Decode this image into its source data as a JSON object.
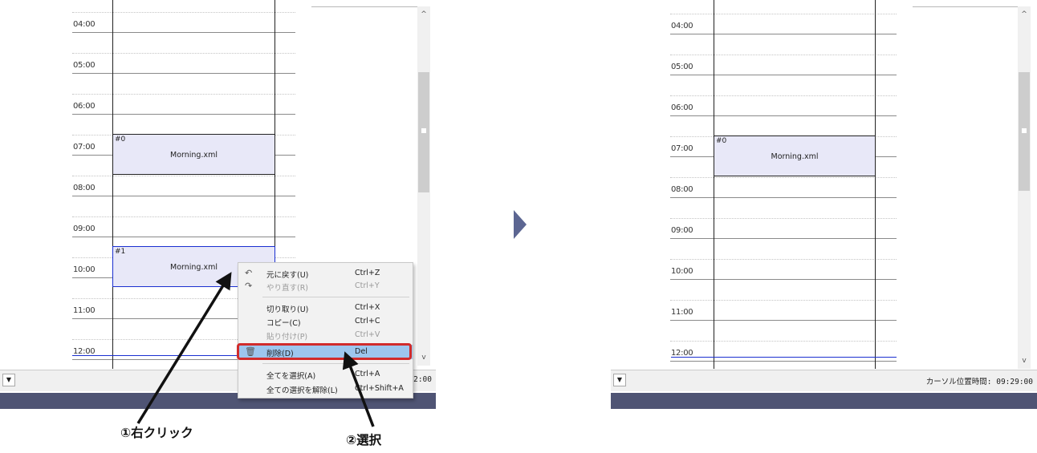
{
  "left": {
    "time_labels": [
      "04:00",
      "05:00",
      "06:00",
      "07:00",
      "08:00",
      "09:00",
      "10:00",
      "11:00",
      "12:00"
    ],
    "blocks": [
      {
        "id": "#0",
        "name": "Morning.xml",
        "selected": false
      },
      {
        "id": "#1",
        "name": "Morning.xml",
        "selected": true
      }
    ],
    "scroll_up": "^",
    "scroll_down": "v",
    "dropdown": "▼",
    "status_text": "2:00"
  },
  "right": {
    "time_labels": [
      "04:00",
      "05:00",
      "06:00",
      "07:00",
      "08:00",
      "09:00",
      "10:00",
      "11:00",
      "12:00"
    ],
    "blocks": [
      {
        "id": "#0",
        "name": "Morning.xml",
        "selected": false
      }
    ],
    "scroll_up": "^",
    "scroll_down": "v",
    "dropdown": "▼",
    "status_text": "カーソル位置時間: 09:29:00"
  },
  "context_menu": {
    "items": [
      {
        "icon": "undo-icon",
        "glyph": "↶",
        "label": "元に戻す(U)",
        "shortcut": "Ctrl+Z",
        "enabled": true
      },
      {
        "icon": "redo-icon",
        "glyph": "↷",
        "label": "やり直す(R)",
        "shortcut": "Ctrl+Y",
        "enabled": false
      },
      {
        "label": "切り取り(U)",
        "shortcut": "Ctrl+X",
        "enabled": true
      },
      {
        "label": "コピー(C)",
        "shortcut": "Ctrl+C",
        "enabled": true
      },
      {
        "label": "貼り付け(P)",
        "shortcut": "Ctrl+V",
        "enabled": false
      },
      {
        "icon": "trash-icon",
        "glyph": "🗑",
        "label": "削除(D)",
        "shortcut": "Del",
        "enabled": true,
        "highlighted": true
      },
      {
        "label": "全てを選択(A)",
        "shortcut": "Ctrl+A",
        "enabled": true
      },
      {
        "label": "全ての選択を解除(L)",
        "shortcut": "Ctrl+Shift+A",
        "enabled": true
      }
    ]
  },
  "annotations": {
    "right_click": "①右クリック",
    "select": "②選択"
  },
  "colors": {
    "block_fill": "#e8e8f8",
    "selected_border": "#1a2fd0",
    "highlight": "#9dc6ee",
    "red_box": "#d12b2b",
    "bottom_bar": "#4f5474",
    "arrow": "#5c6692"
  }
}
